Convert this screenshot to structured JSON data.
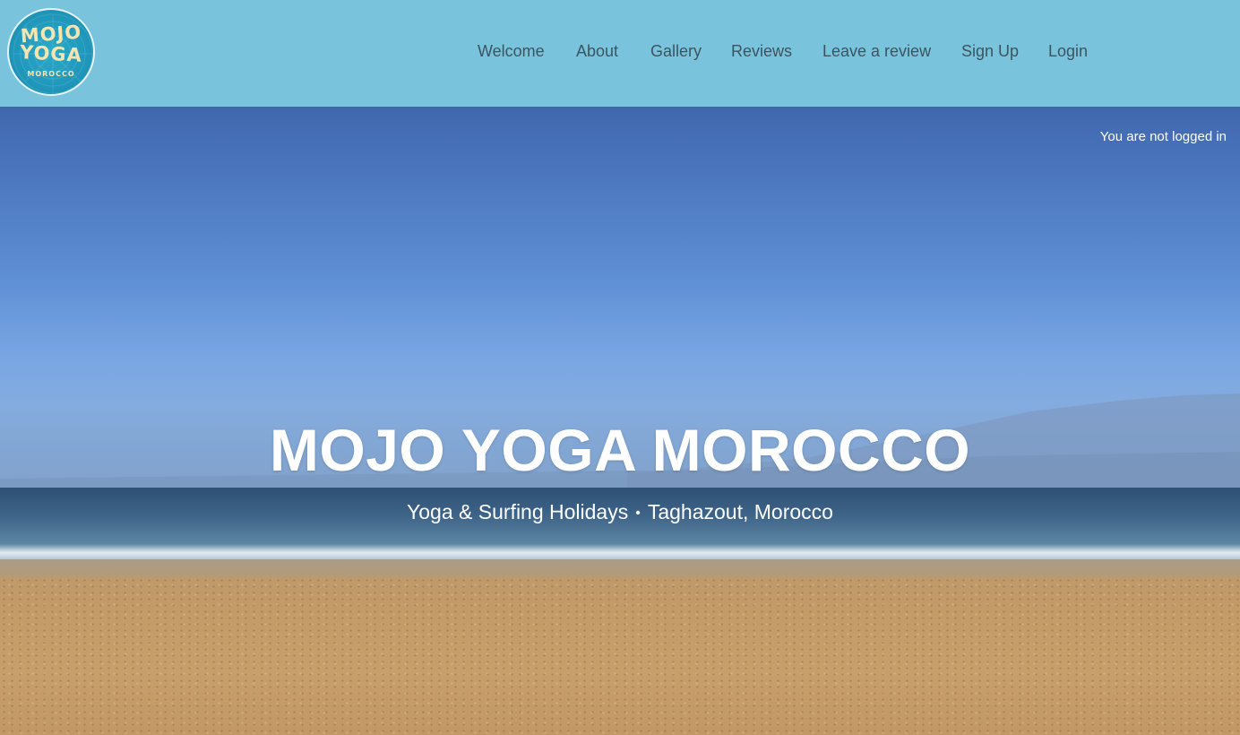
{
  "logo": {
    "line1": "MOJO",
    "line2": "YOGA",
    "line3": "MOROCCO",
    "colors": {
      "circle": "#1f97bb",
      "text": "#f4e4b0"
    }
  },
  "nav": {
    "items": [
      {
        "label": "Welcome"
      },
      {
        "label": "About"
      },
      {
        "label": "Gallery"
      },
      {
        "label": "Reviews"
      },
      {
        "label": "Leave a review"
      },
      {
        "label": "Sign Up"
      },
      {
        "label": "Login"
      }
    ],
    "colors": {
      "background": "#7ac3dc",
      "link": "#3b5560"
    }
  },
  "hero": {
    "login_status": "You are not logged in",
    "title": "MOJO YOGA MOROCCO",
    "subtitle_left": "Yoga & Surfing Holidays",
    "subtitle_separator": "•",
    "subtitle_right": "Taghazout, Morocco",
    "background": "beach-sea-sky-photo"
  }
}
